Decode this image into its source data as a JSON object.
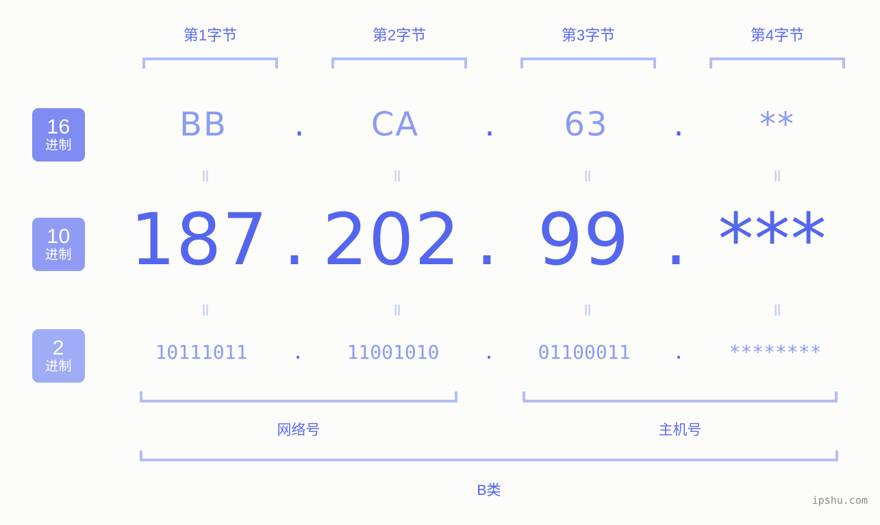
{
  "page": {
    "background_color": "#fcfdfa",
    "accent_color": "#5566ee",
    "accent_light_color": "#8c9bf2",
    "bracket_color": "#b4bcf9",
    "watermark": "ipshu.com"
  },
  "byte_headers": [
    {
      "label": "第1字节"
    },
    {
      "label": "第2字节"
    },
    {
      "label": "第3字节"
    },
    {
      "label": "第4字节"
    }
  ],
  "bases": [
    {
      "number": "16",
      "word": "进制",
      "color": "#7f8cf2"
    },
    {
      "number": "10",
      "word": "进制",
      "color": "#909cf4"
    },
    {
      "number": "2",
      "word": "进制",
      "color": "#9facf6"
    }
  ],
  "rows": {
    "hex": {
      "values": [
        "BB",
        "CA",
        "63",
        "**"
      ],
      "separator": "."
    },
    "decimal": {
      "values": [
        "187",
        "202",
        "99",
        "***"
      ],
      "separator": "."
    },
    "binary": {
      "values": [
        "10111011",
        "11001010",
        "01100011",
        "********"
      ],
      "separator": "."
    }
  },
  "equals_symbol": "=",
  "sections": [
    {
      "label": "网络号"
    },
    {
      "label": "主机号"
    }
  ],
  "class": {
    "label": "B类"
  }
}
